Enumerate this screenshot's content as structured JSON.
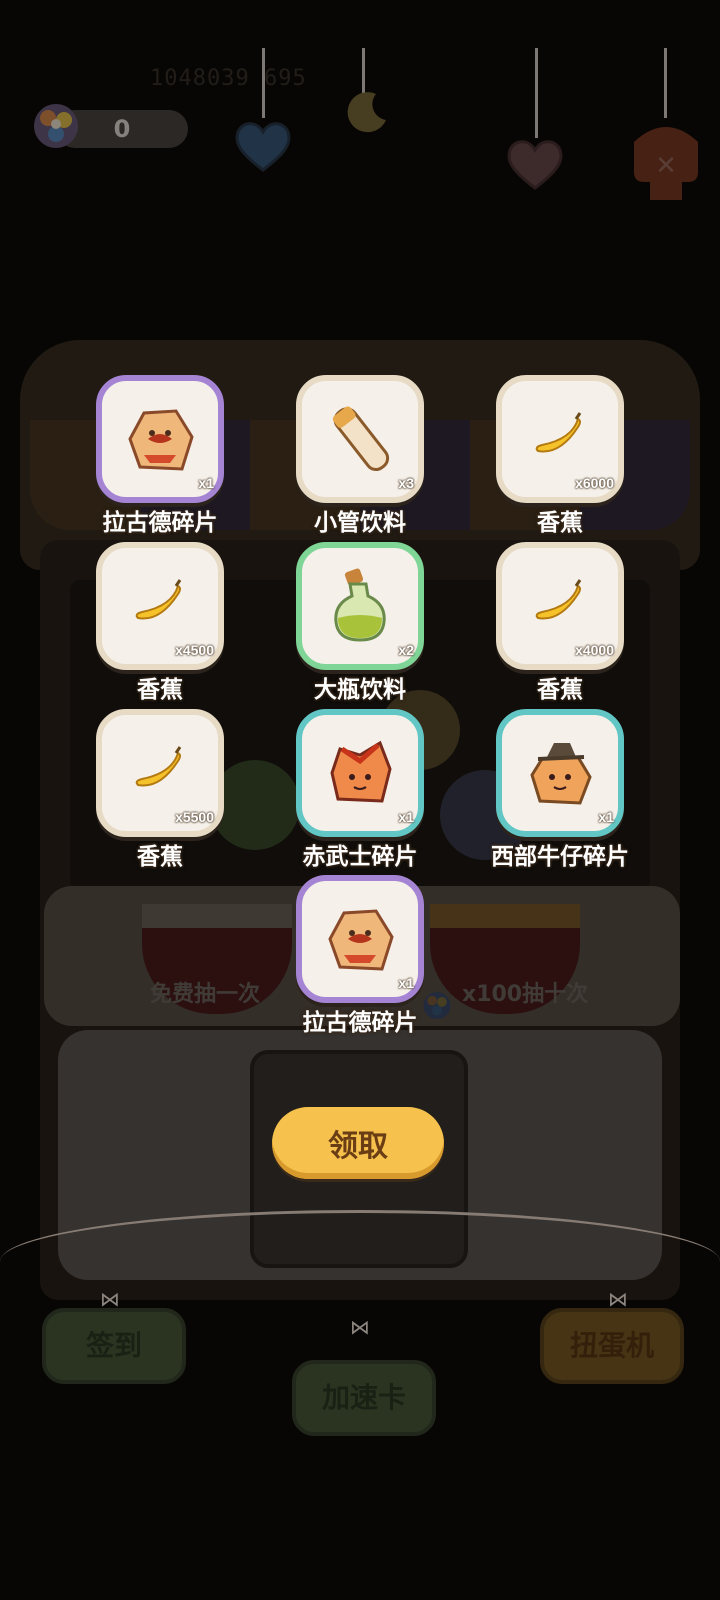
{
  "header": {
    "coin_count": "0",
    "dim_stats": "1048039   695"
  },
  "rewards": [
    {
      "name": "拉古德碎片",
      "qty": "x1",
      "frame": "purple",
      "icon": "lagood-fragment-icon"
    },
    {
      "name": "小管饮料",
      "qty": "x3",
      "frame": "cream",
      "icon": "small-tube-drink-icon"
    },
    {
      "name": "香蕉",
      "qty": "x6000",
      "frame": "cream",
      "icon": "banana-icon"
    },
    {
      "name": "香蕉",
      "qty": "x4500",
      "frame": "cream",
      "icon": "banana-icon"
    },
    {
      "name": "大瓶饮料",
      "qty": "x2",
      "frame": "green",
      "icon": "big-bottle-drink-icon"
    },
    {
      "name": "香蕉",
      "qty": "x4000",
      "frame": "cream",
      "icon": "banana-icon"
    },
    {
      "name": "香蕉",
      "qty": "x5500",
      "frame": "cream",
      "icon": "banana-icon"
    },
    {
      "name": "赤武士碎片",
      "qty": "x1",
      "frame": "teal",
      "icon": "red-samurai-fragment-icon"
    },
    {
      "name": "西部牛仔碎片",
      "qty": "x1",
      "frame": "teal",
      "icon": "western-cowboy-fragment-icon"
    },
    {
      "name": "拉古德碎片",
      "qty": "x1",
      "frame": "purple",
      "icon": "lagood-fragment-icon"
    }
  ],
  "machine": {
    "free_draw_label": "免费抽一次",
    "ten_draw_label": "x100抽十次"
  },
  "claim_button": "领取",
  "bottom_nav": {
    "checkin": "签到",
    "speedup": "加速卡",
    "gacha": "扭蛋机"
  },
  "colors": {
    "claim_button": "#f6c24d",
    "frame_purple": "#a484d3",
    "frame_green": "#7fd596",
    "frame_teal": "#62c7c4",
    "frame_cream": "#e7dbc5"
  }
}
